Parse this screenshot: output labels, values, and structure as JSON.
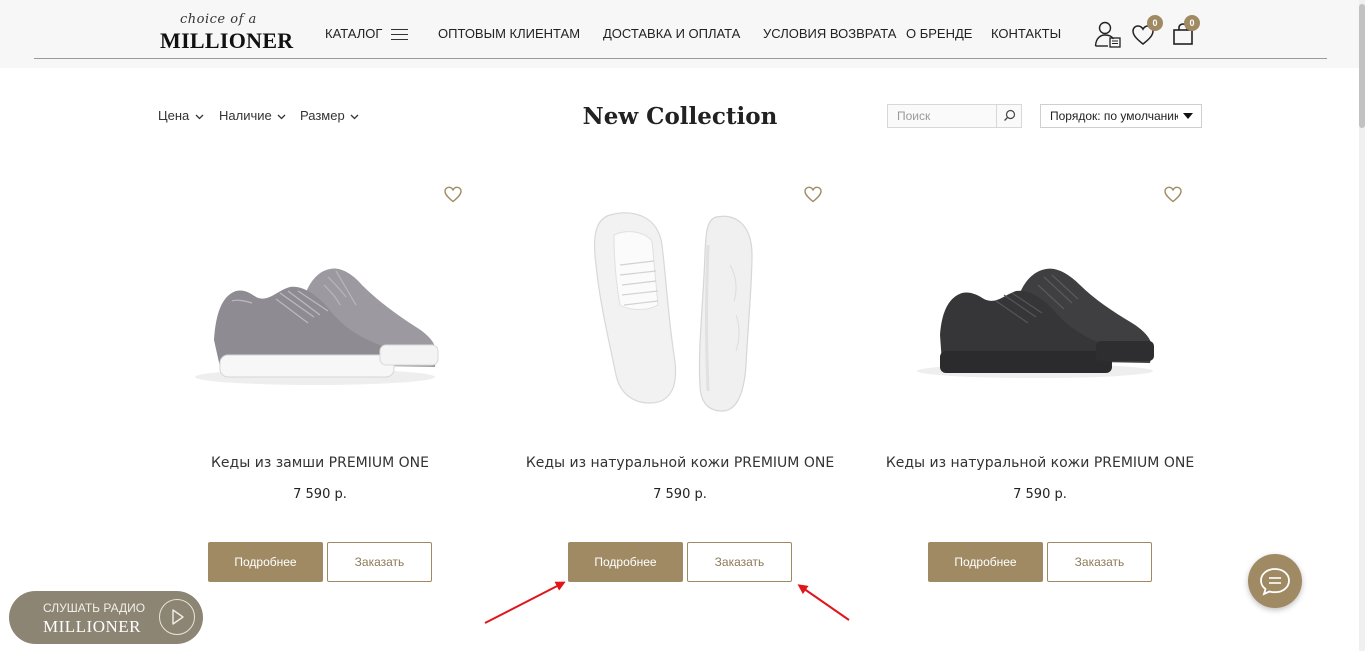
{
  "header": {
    "logo_script": "choice of a",
    "logo_main": "MILLIONER",
    "nav": {
      "catalog": "КАТАЛОГ",
      "wholesale": "ОПТОВЫМ КЛИЕНТАМ",
      "delivery": "ДОСТАВКА И ОПЛАТА",
      "returns": "УСЛОВИЯ ВОЗВРАТА",
      "brand": "О БРЕНДЕ",
      "contacts": "КОНТАКТЫ"
    },
    "icons": {
      "account": "user-icon",
      "wishlist": "heart-icon",
      "cart": "bag-icon",
      "menu": "hamburger-icon"
    },
    "wishlist_count": "0",
    "cart_count": "0"
  },
  "toolbar": {
    "filters": {
      "price": "Цена",
      "availability": "Наличие",
      "size": "Размер"
    },
    "title": "New Collection",
    "search_placeholder": "Поиск",
    "sort_label": "Порядок: по умолчанию"
  },
  "products": [
    {
      "name": "Кеды из замши PREMIUM ONE",
      "price": "7 590 р.",
      "more_label": "Подробнее",
      "order_label": "Заказать",
      "color": "grey-suede"
    },
    {
      "name": "Кеды из натуральной кожи PREMIUM ONE",
      "price": "7 590 р.",
      "more_label": "Подробнее",
      "order_label": "Заказать",
      "color": "white-leather"
    },
    {
      "name": "Кеды из натуральной кожи PREMIUM ONE",
      "price": "7 590 р.",
      "more_label": "Подробнее",
      "order_label": "Заказать",
      "color": "black-leather"
    }
  ],
  "radio": {
    "line1": "СЛУШАТЬ РАДИО",
    "line2": "MILLIONER"
  },
  "colors": {
    "accent": "#a08a63",
    "radio_bg": "#8c8574",
    "annotation": "#e0161b"
  }
}
